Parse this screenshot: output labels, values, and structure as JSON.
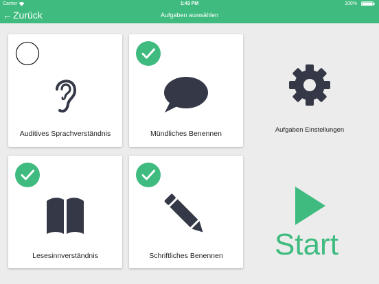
{
  "status_bar": {
    "carrier": "Carrier",
    "time": "1:43 PM",
    "battery": "100%",
    "wifi_icon": "wifi-icon",
    "battery_icon": "battery-icon"
  },
  "nav": {
    "back_arrow": "←",
    "back_label": "Zurück",
    "title": "Aufgaben auswählen"
  },
  "tasks": [
    {
      "label": "Auditives Sprachverständnis",
      "icon": "ear-icon",
      "selected": false
    },
    {
      "label": "Mündliches Benennen",
      "icon": "speech-bubble-icon",
      "selected": true
    },
    {
      "label": "Lesesinnverständnis",
      "icon": "book-icon",
      "selected": true
    },
    {
      "label": "Schriftliches Benennen",
      "icon": "pencil-icon",
      "selected": true
    }
  ],
  "settings": {
    "label": "Aufgaben Einstellungen",
    "icon": "gear-icon"
  },
  "start": {
    "label": "Start",
    "icon": "play-icon"
  },
  "colors": {
    "accent": "#3fbb7f",
    "icon_dark": "#353847",
    "background": "#ececec"
  }
}
